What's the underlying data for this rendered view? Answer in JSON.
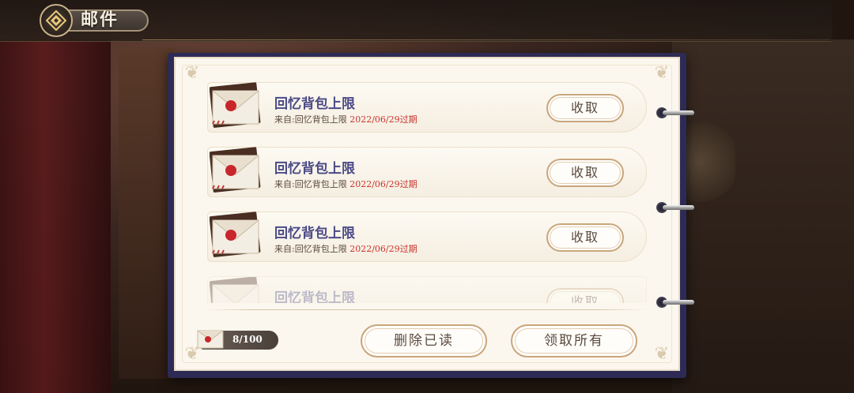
{
  "header": {
    "title": "邮件",
    "emblem_icon": "diamond-emblem-icon"
  },
  "mails": [
    {
      "title": "回忆背包上限",
      "from": "来自:回忆背包上限",
      "expire": "2022/06/29过期",
      "claim_label": "收取"
    },
    {
      "title": "回忆背包上限",
      "from": "来自:回忆背包上限",
      "expire": "2022/06/29过期",
      "claim_label": "收取"
    },
    {
      "title": "回忆背包上限",
      "from": "来自:回忆背包上限",
      "expire": "2022/06/29过期",
      "claim_label": "收取"
    },
    {
      "title": "回忆背包上限",
      "claim_label": "收取"
    }
  ],
  "footer": {
    "mail_count": "8/100",
    "delete_read_label": "删除已读",
    "claim_all_label": "领取所有"
  },
  "colors": {
    "title": "#4a4a86",
    "expire": "#c8322c",
    "panel": "#fbf7ee",
    "binder": "#2d2b55"
  }
}
